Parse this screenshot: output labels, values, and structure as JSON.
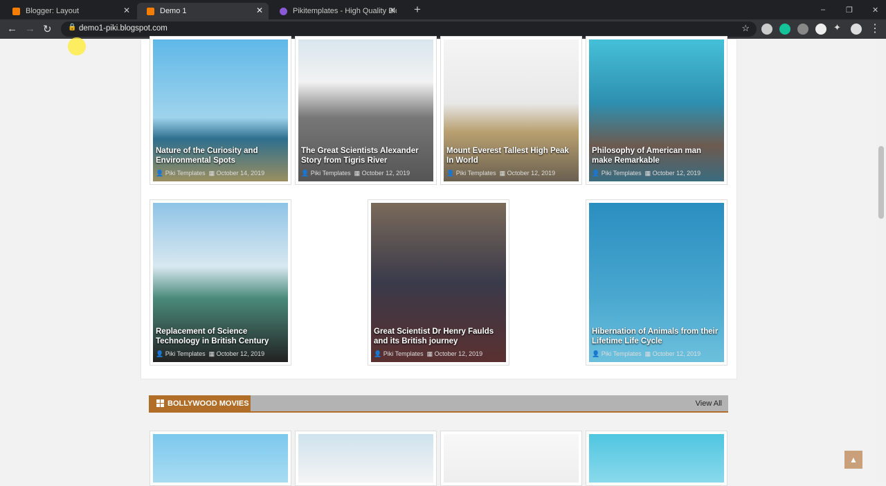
{
  "browser": {
    "tabs": [
      {
        "title": "Blogger: Layout"
      },
      {
        "title": "Demo 1"
      },
      {
        "title": "Pikitemplates - High Quality Blog"
      }
    ],
    "url": "demo1-piki.blogspot.com"
  },
  "posts": [
    {
      "title": "Nature of the Curiosity and Environmental Spots",
      "author": "Piki Templates",
      "date": "October 14, 2019"
    },
    {
      "title": "The Great Scientists Alexander Story from Tigris River",
      "author": "Piki Templates",
      "date": "October 12, 2019"
    },
    {
      "title": "Mount Everest Tallest High Peak In World",
      "author": "Piki Templates",
      "date": "October 12, 2019"
    },
    {
      "title": "Philosophy of American man make Remarkable",
      "author": "Piki Templates",
      "date": "October 12, 2019"
    },
    {
      "title": "Replacement of Science Technology in British Century",
      "author": "Piki Templates",
      "date": "October 12, 2019"
    },
    {
      "title": "Great Scientist Dr Henry Faulds and its British journey",
      "author": "Piki Templates",
      "date": "October 12, 2019"
    },
    {
      "title": "Hibernation of Animals from their Lifetime Life Cycle",
      "author": "Piki Templates",
      "date": "October 12, 2019"
    }
  ],
  "section": {
    "title": "BOLLYWOOD MOVIES",
    "view_all": "View All"
  },
  "colors": {
    "accent": "#b06e28"
  }
}
